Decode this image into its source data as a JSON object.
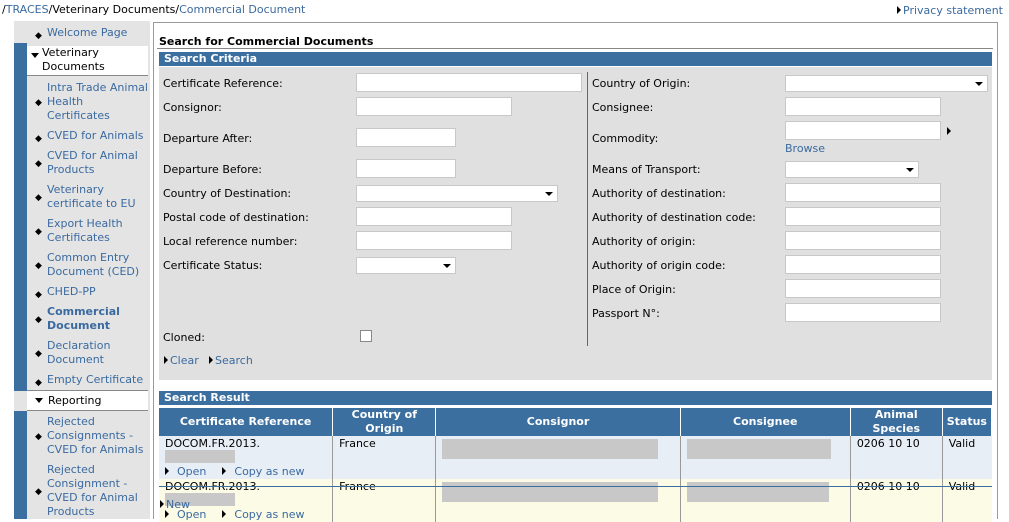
{
  "breadcrumb": {
    "root": "TRACES",
    "level1": "Veterinary Documents",
    "level2": "Commercial Document"
  },
  "privacy_label": "Privacy statement",
  "sidebar": {
    "welcome": "Welcome Page",
    "vet_docs_head": "Veterinary Documents",
    "items": [
      "Intra Trade Animal Health Certificates",
      "CVED for Animals",
      "CVED for Animal Products",
      "Veterinary certificate to EU",
      "Export Health Certificates",
      "Common Entry Document (CED)",
      "CHED-PP",
      "Commercial Document",
      "Declaration Document",
      "Empty Certificate"
    ],
    "reporting_head": "Reporting",
    "reporting_items": [
      "Rejected Consignments - CVED for Animals",
      "Rejected Consignment - CVED for Animal Products"
    ]
  },
  "page_title": "Search for Commercial Documents",
  "criteria_title": "Search Criteria",
  "left_fields": {
    "certificate_reference": "Certificate Reference:",
    "consignor": "Consignor:",
    "departure_after": "Departure After:",
    "departure_before": "Departure Before:",
    "country_destination": "Country of Destination:",
    "postal_code": "Postal code of destination:",
    "local_reference": "Local reference number:",
    "certificate_status": "Certificate Status:",
    "cloned": "Cloned:"
  },
  "right_fields": {
    "country_origin": "Country of Origin:",
    "consignee": "Consignee:",
    "commodity": "Commodity:",
    "browse": "Browse",
    "means_transport": "Means of Transport:",
    "authority_dest": "Authority of destination:",
    "authority_dest_code": "Authority of destination code:",
    "authority_origin": "Authority of origin:",
    "authority_origin_code": "Authority of origin code:",
    "place_origin": "Place of Origin:",
    "passport": "Passport N°:"
  },
  "actions": {
    "clear": "Clear",
    "search": "Search"
  },
  "result_title": "Search Result",
  "result_columns": [
    "Certificate Reference",
    "Country of Origin",
    "Consignor",
    "Consignee",
    "Animal Species",
    "Status"
  ],
  "result_rows": [
    {
      "ref": "DOCOM.FR.2013.",
      "country": "France",
      "species": "0206 10 10",
      "status": "Valid"
    },
    {
      "ref": "DOCOM.FR.2013.",
      "country": "France",
      "species": "0206 10 10",
      "status": "Valid"
    }
  ],
  "row_links": {
    "open": "Open",
    "copy": "Copy as new"
  },
  "new_label": "New"
}
